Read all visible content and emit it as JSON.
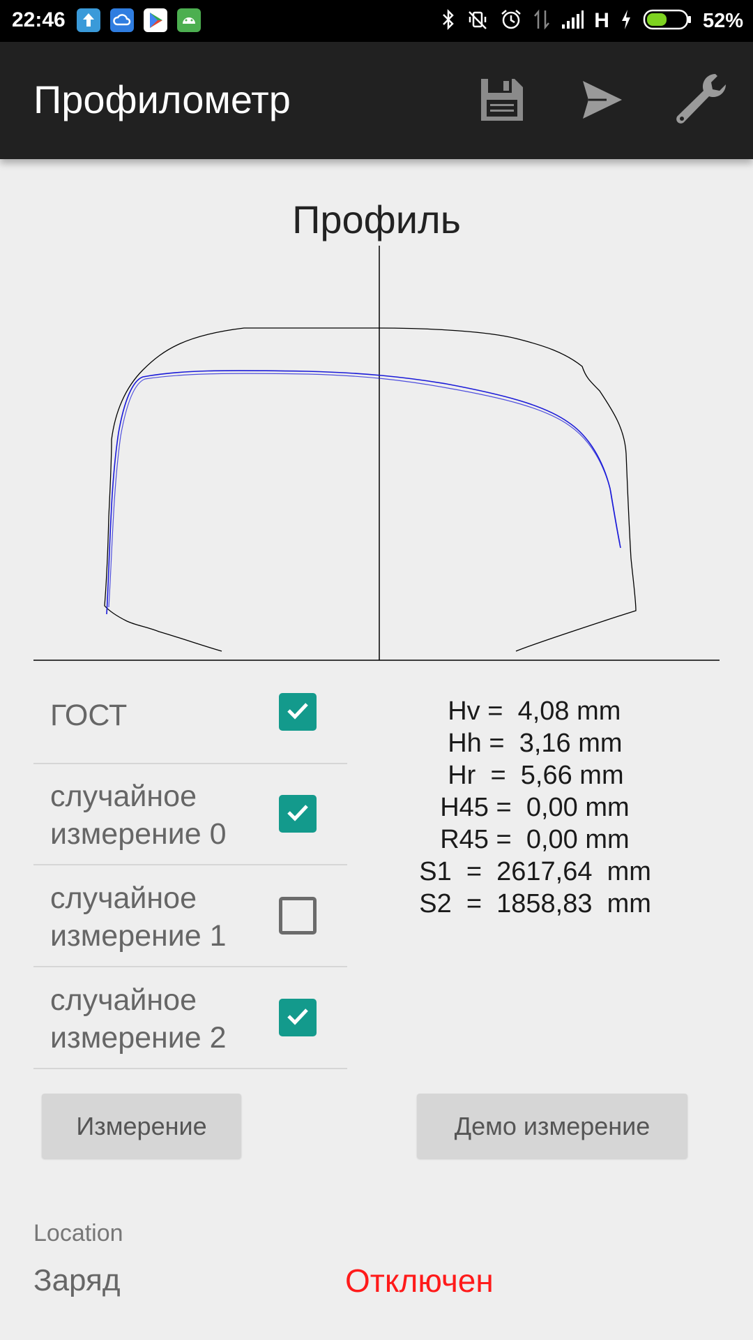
{
  "status_bar": {
    "time": "22:46",
    "network": "H",
    "battery_percent": "52%",
    "battery_level": 0.52,
    "notification_icons": [
      "upload-icon",
      "cloud-icon",
      "play-store-icon",
      "android-icon"
    ],
    "system_icons": [
      "bluetooth-icon",
      "mute-icon",
      "alarm-icon",
      "data-icon",
      "signal-icon",
      "charging-icon",
      "battery-icon"
    ]
  },
  "toolbar": {
    "title": "Профилометр",
    "actions": [
      "save-icon",
      "send-icon",
      "wrench-icon"
    ]
  },
  "chart": {
    "title": "Профиль",
    "profile_colors": {
      "template": "#000000",
      "measured": "#1a1ad8"
    }
  },
  "measurements": [
    {
      "label": "ГОСТ",
      "checked": true
    },
    {
      "label": "случайное\nизмерение 0",
      "checked": true
    },
    {
      "label": "случайное\nизмерение 1",
      "checked": false
    },
    {
      "label": "случайное\nизмерение 2",
      "checked": true
    }
  ],
  "metrics": [
    {
      "name": "Hv",
      "value": "4,08",
      "unit": "mm"
    },
    {
      "name": "Hh",
      "value": "3,16",
      "unit": "mm"
    },
    {
      "name": "Hr",
      "value": "5,66",
      "unit": "mm"
    },
    {
      "name": "H45",
      "value": "0,00",
      "unit": "mm"
    },
    {
      "name": "R45",
      "value": "0,00",
      "unit": "mm"
    },
    {
      "name": "S1",
      "value": "2617,64",
      "unit": "mm"
    },
    {
      "name": "S2",
      "value": "1858,83",
      "unit": "mm"
    }
  ],
  "buttons": {
    "measure": "Измерение",
    "demo": "Демо измерение"
  },
  "footer": {
    "location_label": "Location",
    "charge_label": "Заряд",
    "charge_status": "Отключен",
    "status_color": "#ff1a1a"
  }
}
